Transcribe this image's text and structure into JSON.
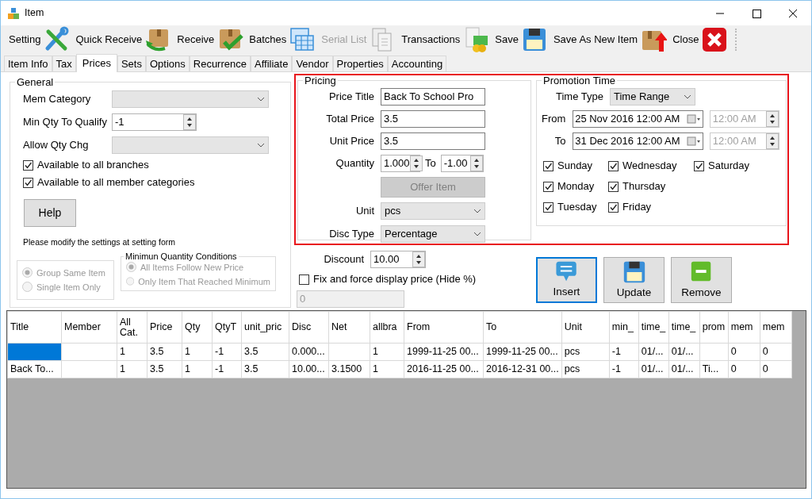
{
  "window": {
    "title": "Item"
  },
  "toolbar": [
    {
      "label": "Setting",
      "kind": "tools",
      "disabled": false
    },
    {
      "label": "Quick Receive",
      "kind": "box-return",
      "disabled": false
    },
    {
      "label": "Receive",
      "kind": "box-check",
      "disabled": false
    },
    {
      "label": "Batches",
      "kind": "grid",
      "disabled": false
    },
    {
      "label": "Serial List",
      "kind": "docs",
      "disabled": true
    },
    {
      "label": "Transactions",
      "kind": "money",
      "disabled": false
    },
    {
      "label": "Save",
      "kind": "floppy",
      "disabled": false
    },
    {
      "label": "Save As New Item",
      "kind": "box-up",
      "disabled": false
    },
    {
      "label": "Close",
      "kind": "close-x",
      "disabled": false
    }
  ],
  "tabs": [
    {
      "label": "Item Info",
      "selected": false
    },
    {
      "label": "Tax",
      "selected": false
    },
    {
      "label": "Prices",
      "selected": true
    },
    {
      "label": "Sets",
      "selected": false
    },
    {
      "label": "Options",
      "selected": false
    },
    {
      "label": "Recurrence",
      "selected": false
    },
    {
      "label": "Affiliate",
      "selected": false
    },
    {
      "label": "Vendor",
      "selected": false
    },
    {
      "label": "Properties",
      "selected": false
    },
    {
      "label": "Accounting",
      "selected": false
    }
  ],
  "general": {
    "title": "General",
    "fields": [
      {
        "kind": "select",
        "label": "Mem Category"
      },
      {
        "kind": "spin",
        "label": "Min Qty To Qualify",
        "value": "-1"
      },
      {
        "kind": "select",
        "label": "Allow Qty Chg"
      }
    ],
    "checkboxes": [
      {
        "label": "Available to all branches",
        "checked": true
      },
      {
        "label": "Available to all member categories",
        "checked": true
      }
    ],
    "help_button": "Help",
    "note": "Please modify the settings at setting form",
    "grouping": {
      "disabled": true,
      "options": [
        {
          "label": "Group Same Item",
          "selected": true
        },
        {
          "label": "Single Item Only",
          "selected": false
        }
      ]
    },
    "min_qty_conditions": {
      "title": "Minimun Quantity Conditions",
      "disabled": true,
      "options": [
        {
          "label": "All Items Follow New Price",
          "selected": true
        },
        {
          "label": "Only Item That Reached Minimum",
          "selected": false
        }
      ]
    }
  },
  "pricing": {
    "title": "Pricing",
    "rows": [
      {
        "kind": "text",
        "label": "Price Title",
        "value": "Back To School Pro"
      },
      {
        "kind": "text",
        "label": "Total Price",
        "value": "3.5"
      },
      {
        "kind": "text",
        "label": "Unit Price",
        "value": "3.5"
      },
      {
        "kind": "range",
        "label": "Quantity",
        "value": "1.000",
        "to_label": "To",
        "to_value": "-1.00"
      },
      {
        "kind": "button",
        "label": "Offer Item",
        "disabled": true
      },
      {
        "kind": "select",
        "label": "Unit",
        "value": "pcs"
      },
      {
        "kind": "select",
        "label": "Disc Type",
        "value": "Percentage"
      }
    ]
  },
  "discount": {
    "label": "Discount",
    "value": "10.00"
  },
  "fix_price": {
    "label": "Fix and force display price (Hide %)",
    "checked": false
  },
  "display_price": {
    "value": "0",
    "disabled": true
  },
  "promotion": {
    "title": "Promotion Time",
    "time_type": {
      "label": "Time Type",
      "value": "Time Range"
    },
    "from": {
      "label": "From",
      "date": "25 Nov 2016 12:00 AM",
      "time": "12:00 AM",
      "time_disabled": true
    },
    "to": {
      "label": "To",
      "date": "31 Dec 2016 12:00 AM",
      "time": "12:00 AM",
      "time_disabled": true
    },
    "days": [
      {
        "label": "Sunday",
        "checked": true
      },
      {
        "label": "Monday",
        "checked": true
      },
      {
        "label": "Tuesday",
        "checked": true
      },
      {
        "label": "Wednesday",
        "checked": true
      },
      {
        "label": "Thursday",
        "checked": true
      },
      {
        "label": "Friday",
        "checked": true
      },
      {
        "label": "Saturday",
        "checked": true
      }
    ]
  },
  "actions": [
    {
      "label": "Insert",
      "kind": "speech",
      "focused": true
    },
    {
      "label": "Update",
      "kind": "floppy",
      "focused": false
    },
    {
      "label": "Remove",
      "kind": "minus",
      "focused": false
    }
  ],
  "table": {
    "columns": [
      "Title",
      "Member",
      "All Cat.",
      "Price",
      "Qty",
      "QtyT",
      "unit_pric",
      "Disc",
      "Net",
      "allbra",
      "From",
      "To",
      "Unit",
      "min_",
      "time_",
      "time_",
      "prom",
      "mem",
      "mem"
    ],
    "rows": [
      {
        "selected": true,
        "cells": [
          null,
          null,
          "1",
          "3.5",
          "1",
          "-1",
          "3.5",
          "0.000...",
          null,
          "1",
          "1999-11-25 00...",
          "1999-11-25 00...",
          "pcs",
          "-1",
          "01/...",
          "01/...",
          null,
          "0",
          "0"
        ]
      },
      {
        "selected": false,
        "cells": [
          "Back To...",
          null,
          "1",
          "3.5",
          "1",
          "-1",
          "3.5",
          "10.00...",
          "3.1500",
          "1",
          "2016-11-25 00...",
          "2016-12-31 00...",
          "pcs",
          "-1",
          "01/...",
          "01/...",
          "Ti...",
          "0",
          "0"
        ]
      }
    ]
  }
}
